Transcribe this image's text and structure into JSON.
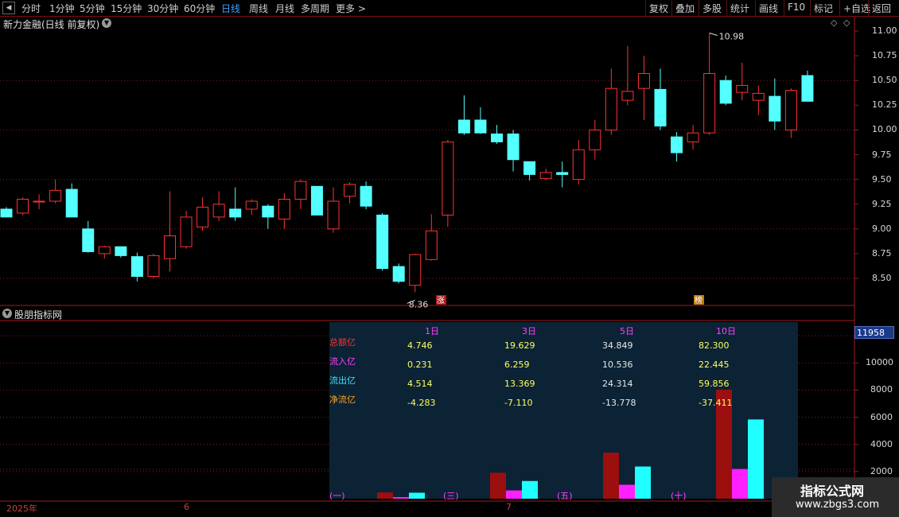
{
  "toolbar": {
    "periods": [
      "分时",
      "1分钟",
      "5分钟",
      "15分钟",
      "30分钟",
      "60分钟",
      "日线",
      "周线",
      "月线",
      "多周期",
      "更多 >"
    ],
    "active_period": "日线",
    "right_buttons": [
      "复权",
      "叠加",
      "多股",
      "统计",
      "画线",
      "F10",
      "标记",
      "+自选",
      "返回"
    ]
  },
  "chart": {
    "title": "新力金融(日线 前复权)",
    "price_ticks": [
      "11.00",
      "10.75",
      "10.50",
      "10.25",
      "10.00",
      "9.75",
      "9.50",
      "9.25",
      "9.00",
      "8.75",
      "8.50"
    ],
    "high_marker": "10.98",
    "low_marker": "8.36",
    "badge_zhang": "涨",
    "badge_bang": "榜"
  },
  "sub_chart": {
    "title": "股朋指标网",
    "value_box": "11958",
    "y_ticks": [
      "12000",
      "10000",
      "8000",
      "6000",
      "4000",
      "2000"
    ],
    "table": {
      "headers": [
        "1日",
        "3日",
        "5日",
        "10日"
      ],
      "rows": [
        {
          "label": "总额亿",
          "values": [
            "4.746",
            "19.629",
            "34.849",
            "82.300"
          ]
        },
        {
          "label": "流入亿",
          "values": [
            "0.231",
            "6.259",
            "10.536",
            "22.445"
          ]
        },
        {
          "label": "流出亿",
          "values": [
            "4.514",
            "13.369",
            "24.314",
            "59.856"
          ]
        },
        {
          "label": "净流亿",
          "values": [
            "-4.283",
            "-7.110",
            "-13.778",
            "-37.411"
          ]
        }
      ],
      "group_labels": [
        "(一)",
        "(三)",
        "(五)",
        "(十)"
      ]
    }
  },
  "dates": [
    "2025年",
    "6",
    "7"
  ],
  "watermark": {
    "title": "指标公式网",
    "url": "www.zbgs3.com"
  },
  "colors": {
    "up": "#ff3232",
    "down": "#54ffff",
    "grid": "#8b1a1a",
    "bar_total": "#9b0f0f",
    "bar_in": "#ff20ff",
    "bar_out": "#20ffff"
  },
  "chart_data": {
    "type": "candlestick",
    "candles": [
      {
        "o": 9.2,
        "c": 9.12,
        "h": 9.22,
        "l": 9.12
      },
      {
        "o": 9.16,
        "c": 9.3,
        "h": 9.32,
        "l": 9.14
      },
      {
        "o": 9.28,
        "c": 9.28,
        "h": 9.35,
        "l": 9.2
      },
      {
        "o": 9.28,
        "c": 9.39,
        "h": 9.5,
        "l": 9.26
      },
      {
        "o": 9.4,
        "c": 9.12,
        "h": 9.46,
        "l": 9.12
      },
      {
        "o": 9.0,
        "c": 8.77,
        "h": 9.08,
        "l": 8.76
      },
      {
        "o": 8.75,
        "c": 8.82,
        "h": 8.83,
        "l": 8.7
      },
      {
        "o": 8.82,
        "c": 8.73,
        "h": 8.82,
        "l": 8.71
      },
      {
        "o": 8.72,
        "c": 8.52,
        "h": 8.76,
        "l": 8.47
      },
      {
        "o": 8.52,
        "c": 8.73,
        "h": 8.75,
        "l": 8.5
      },
      {
        "o": 8.7,
        "c": 8.93,
        "h": 9.38,
        "l": 8.57
      },
      {
        "o": 8.82,
        "c": 9.12,
        "h": 9.18,
        "l": 8.8
      },
      {
        "o": 9.02,
        "c": 9.22,
        "h": 9.32,
        "l": 8.98
      },
      {
        "o": 9.12,
        "c": 9.25,
        "h": 9.38,
        "l": 9.08
      },
      {
        "o": 9.2,
        "c": 9.12,
        "h": 9.42,
        "l": 9.08
      },
      {
        "o": 9.2,
        "c": 9.28,
        "h": 9.3,
        "l": 9.14
      },
      {
        "o": 9.23,
        "c": 9.12,
        "h": 9.25,
        "l": 9.0
      },
      {
        "o": 9.1,
        "c": 9.3,
        "h": 9.36,
        "l": 9.0
      },
      {
        "o": 9.3,
        "c": 9.48,
        "h": 9.5,
        "l": 9.2
      },
      {
        "o": 9.43,
        "c": 9.14,
        "h": 9.43,
        "l": 9.14
      },
      {
        "o": 9.0,
        "c": 9.28,
        "h": 9.42,
        "l": 8.96
      },
      {
        "o": 9.33,
        "c": 9.45,
        "h": 9.47,
        "l": 9.26
      },
      {
        "o": 9.43,
        "c": 9.23,
        "h": 9.48,
        "l": 9.2
      },
      {
        "o": 9.14,
        "c": 8.6,
        "h": 9.16,
        "l": 8.58
      },
      {
        "o": 8.62,
        "c": 8.47,
        "h": 8.65,
        "l": 8.45
      },
      {
        "o": 8.43,
        "c": 8.74,
        "h": 8.75,
        "l": 8.36
      },
      {
        "o": 8.69,
        "c": 8.98,
        "h": 9.15,
        "l": 8.68
      },
      {
        "o": 9.14,
        "c": 9.88,
        "h": 9.9,
        "l": 9.02
      },
      {
        "o": 10.1,
        "c": 9.97,
        "h": 10.35,
        "l": 9.95
      },
      {
        "o": 10.1,
        "c": 9.97,
        "h": 10.23,
        "l": 9.96
      },
      {
        "o": 9.96,
        "c": 9.88,
        "h": 10.05,
        "l": 9.86
      },
      {
        "o": 9.96,
        "c": 9.7,
        "h": 10.0,
        "l": 9.58
      },
      {
        "o": 9.68,
        "c": 9.55,
        "h": 9.68,
        "l": 9.49
      },
      {
        "o": 9.51,
        "c": 9.57,
        "h": 9.61,
        "l": 9.49
      },
      {
        "o": 9.57,
        "c": 9.55,
        "h": 9.68,
        "l": 9.42
      },
      {
        "o": 9.5,
        "c": 9.8,
        "h": 9.9,
        "l": 9.45
      },
      {
        "o": 9.8,
        "c": 10.0,
        "h": 10.1,
        "l": 9.7
      },
      {
        "o": 10.0,
        "c": 10.42,
        "h": 10.62,
        "l": 9.95
      },
      {
        "o": 10.3,
        "c": 10.39,
        "h": 10.85,
        "l": 10.25
      },
      {
        "o": 10.42,
        "c": 10.57,
        "h": 10.75,
        "l": 10.1
      },
      {
        "o": 10.41,
        "c": 10.04,
        "h": 10.62,
        "l": 10.0
      },
      {
        "o": 9.93,
        "c": 9.77,
        "h": 9.98,
        "l": 9.68
      },
      {
        "o": 9.88,
        "c": 9.97,
        "h": 10.05,
        "l": 9.8
      },
      {
        "o": 9.97,
        "c": 10.57,
        "h": 10.98,
        "l": 9.95
      },
      {
        "o": 10.5,
        "c": 10.27,
        "h": 10.55,
        "l": 10.25
      },
      {
        "o": 10.38,
        "c": 10.45,
        "h": 10.68,
        "l": 10.3
      },
      {
        "o": 10.3,
        "c": 10.37,
        "h": 10.45,
        "l": 10.15
      },
      {
        "o": 10.34,
        "c": 10.09,
        "h": 10.52,
        "l": 10.0
      },
      {
        "o": 10.0,
        "c": 10.4,
        "h": 10.42,
        "l": 9.92
      },
      {
        "o": 10.55,
        "c": 10.29,
        "h": 10.6,
        "l": 10.29
      }
    ],
    "subchart_bars": [
      {
        "group": "(一)",
        "total": 4.746,
        "inflow": 0.231,
        "outflow": 4.514
      },
      {
        "group": "(三)",
        "total": 19.629,
        "inflow": 6.259,
        "outflow": 13.369
      },
      {
        "group": "(五)",
        "total": 34.849,
        "inflow": 10.536,
        "outflow": 24.314
      },
      {
        "group": "(十)",
        "total": 82.3,
        "inflow": 22.445,
        "outflow": 59.856
      }
    ],
    "price_range": [
      8.3,
      11.1
    ]
  }
}
